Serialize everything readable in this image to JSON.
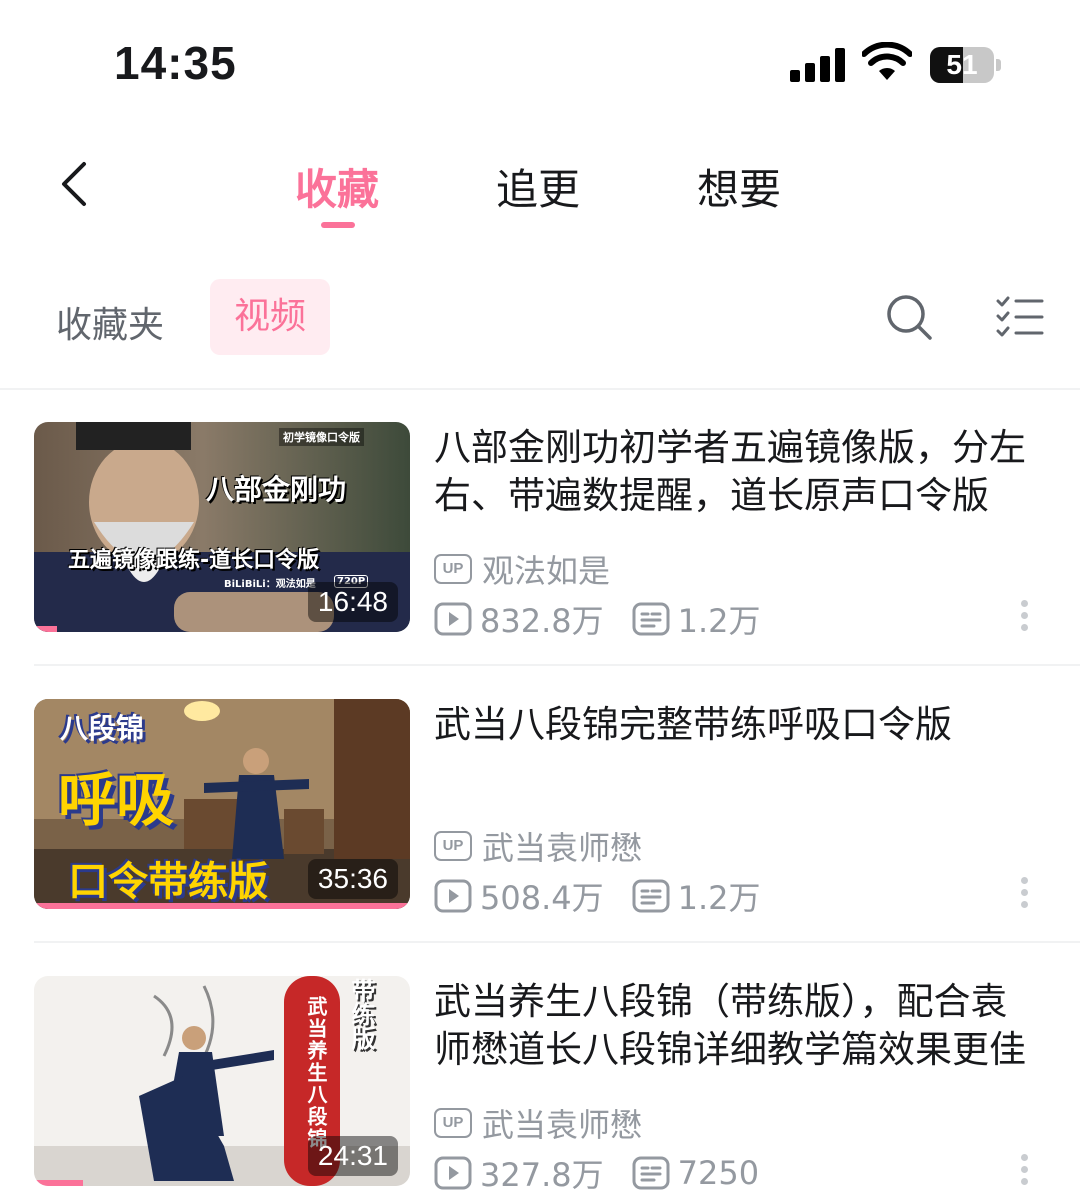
{
  "status_bar": {
    "time": "14:35",
    "battery": "51"
  },
  "header": {
    "tabs": [
      {
        "label": "收藏",
        "active": true
      },
      {
        "label": "追更",
        "active": false
      },
      {
        "label": "想要",
        "active": false
      }
    ]
  },
  "subbar": {
    "folder_label": "收藏夹",
    "chip_label": "视频"
  },
  "videos": [
    {
      "title": "八部金刚功初学者五遍镜像版，分左右、带遍数提醒，道长原声口令版",
      "uploader": "观法如是",
      "up_badge": "UP",
      "views": "832.8万",
      "comments": "1.2万",
      "duration": "16:48",
      "progress": 0.06,
      "thumb_texts": {
        "tag": "初学镜像口令版",
        "main": "八部金刚功",
        "sub": "五遍镜像跟练-道长口令版",
        "brand": "BiLiBiLi：观法如是",
        "quality": "720P"
      }
    },
    {
      "title": "武当八段锦完整带练呼吸口令版",
      "uploader": "武当袁师懋",
      "up_badge": "UP",
      "views": "508.4万",
      "comments": "1.2万",
      "duration": "35:36",
      "progress": 1.0,
      "thumb_texts": {
        "top": "八段锦",
        "main": "呼吸",
        "bottom": "口令带练版"
      }
    },
    {
      "title": "武当养生八段锦（带练版），配合袁师懋道长八段锦详细教学篇效果更佳",
      "uploader": "武当袁师懋",
      "up_badge": "UP",
      "views": "327.8万",
      "comments": "7250",
      "duration": "24:31",
      "progress": 0.13,
      "thumb_texts": {
        "banner": "武当养生八段锦",
        "side": "带练版"
      }
    }
  ],
  "colors": {
    "accent": "#fb7299",
    "accent_bg": "#ffecf1",
    "secondary_text": "#9499a0"
  }
}
